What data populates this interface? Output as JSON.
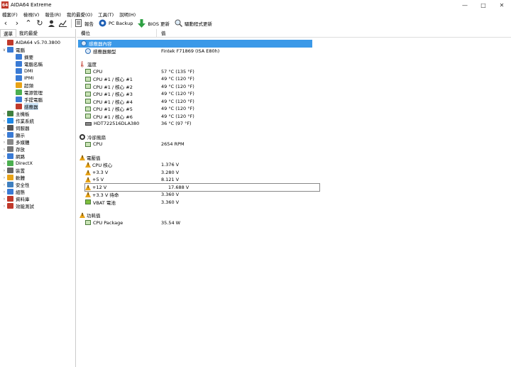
{
  "window": {
    "title": "AIDA64 Extreme",
    "app_icon_text": "64",
    "minimize": "—",
    "maximize": "□",
    "close": "✕"
  },
  "menu": [
    "檔案(F)",
    "檢視(V)",
    "報告(R)",
    "我的最愛(O)",
    "工具(T)",
    "說明(H)"
  ],
  "toolbar": {
    "report": "報告",
    "pc_backup": "PC Backup",
    "bios_update": "BIOS 更新",
    "driver_update": "驅動程式更新"
  },
  "left": {
    "tabs": [
      "選單",
      "我的最愛"
    ],
    "tree": [
      {
        "label": "AIDA64 v5.70.3800",
        "level": 0,
        "exp": "",
        "color": "#c0392b"
      },
      {
        "label": "電腦",
        "level": 0,
        "exp": "∨",
        "color": "#3a7bd5"
      },
      {
        "label": "摘要",
        "level": 1,
        "exp": "",
        "color": "#3a7bd5"
      },
      {
        "label": "電腦名稱",
        "level": 1,
        "exp": "",
        "color": "#3a7bd5"
      },
      {
        "label": "DMI",
        "level": 1,
        "exp": "",
        "color": "#3a7bd5"
      },
      {
        "label": "IPMI",
        "level": 1,
        "exp": "",
        "color": "#3a7bd5"
      },
      {
        "label": "超頻",
        "level": 1,
        "exp": "",
        "color": "#e8a317"
      },
      {
        "label": "電源管理",
        "level": 1,
        "exp": "",
        "color": "#4caf50"
      },
      {
        "label": "手提電腦",
        "level": 1,
        "exp": "",
        "color": "#3a7bd5"
      },
      {
        "label": "感應器",
        "level": 1,
        "exp": "",
        "color": "#c0392b",
        "selected": true
      },
      {
        "label": "主機板",
        "level": 0,
        "exp": "›",
        "color": "#3f7f3f"
      },
      {
        "label": "作業系統",
        "level": 0,
        "exp": "›",
        "color": "#1e88e5"
      },
      {
        "label": "伺服器",
        "level": 0,
        "exp": "›",
        "color": "#555555"
      },
      {
        "label": "顯示",
        "level": 0,
        "exp": "›",
        "color": "#3a7bd5"
      },
      {
        "label": "多媒體",
        "level": 0,
        "exp": "›",
        "color": "#888888"
      },
      {
        "label": "存放",
        "level": 0,
        "exp": "›",
        "color": "#777777"
      },
      {
        "label": "網路",
        "level": 0,
        "exp": "›",
        "color": "#3a7bd5"
      },
      {
        "label": "DirectX",
        "level": 0,
        "exp": "›",
        "color": "#4caf50"
      },
      {
        "label": "裝置",
        "level": 0,
        "exp": "›",
        "color": "#666666"
      },
      {
        "label": "軟體",
        "level": 0,
        "exp": "›",
        "color": "#e8a317"
      },
      {
        "label": "安全性",
        "level": 0,
        "exp": "›",
        "color": "#3f7fbf"
      },
      {
        "label": "組態",
        "level": 0,
        "exp": "›",
        "color": "#3a7bd5"
      },
      {
        "label": "資料庫",
        "level": 0,
        "exp": "›",
        "color": "#c0392b"
      },
      {
        "label": "效能測試",
        "level": 0,
        "exp": "›",
        "color": "#c0392b"
      }
    ]
  },
  "right": {
    "col_field": "欄位",
    "col_value": "值",
    "sensor_props": {
      "header": "感應器內容",
      "type_label": "感應器類型",
      "type_value": "Fintek F71869  (ISA E80h)"
    },
    "temps": {
      "header": "溫度",
      "rows": [
        {
          "label": "CPU",
          "value": "57 °C  (135 °F)",
          "icon": "sq"
        },
        {
          "label": "CPU #1 / 核心 #1",
          "value": "49 °C  (120 °F)",
          "icon": "sq"
        },
        {
          "label": "CPU #1 / 核心 #2",
          "value": "49 °C  (120 °F)",
          "icon": "sq"
        },
        {
          "label": "CPU #1 / 核心 #3",
          "value": "49 °C  (120 °F)",
          "icon": "sq"
        },
        {
          "label": "CPU #1 / 核心 #4",
          "value": "49 °C  (120 °F)",
          "icon": "sq"
        },
        {
          "label": "CPU #1 / 核心 #5",
          "value": "49 °C  (120 °F)",
          "icon": "sq"
        },
        {
          "label": "CPU #1 / 核心 #6",
          "value": "49 °C  (120 °F)",
          "icon": "sq"
        },
        {
          "label": "HDT722516DLA380",
          "value": "36 °C  (97 °F)",
          "icon": "hdd"
        }
      ]
    },
    "fans": {
      "header": "冷卻風扇",
      "rows": [
        {
          "label": "CPU",
          "value": "2654 RPM",
          "icon": "sq"
        }
      ]
    },
    "volts": {
      "header": "電壓值",
      "rows": [
        {
          "label": "CPU 核心",
          "value": "1.376 V",
          "icon": "warn"
        },
        {
          "label": "+3.3 V",
          "value": "3.280 V",
          "icon": "warn"
        },
        {
          "label": "+5 V",
          "value": "8.121 V",
          "icon": "warn"
        },
        {
          "label": "+12 V",
          "value": "17.688 V",
          "icon": "warn",
          "boxed": true
        },
        {
          "label": "+3.3 V 待命",
          "value": "3.360 V",
          "icon": "warn"
        },
        {
          "label": "VBAT 電池",
          "value": "3.360 V",
          "icon": "battery"
        }
      ]
    },
    "power": {
      "header": "功耗值",
      "rows": [
        {
          "label": "CPU Package",
          "value": "35.54 W",
          "icon": "sq"
        }
      ]
    }
  }
}
